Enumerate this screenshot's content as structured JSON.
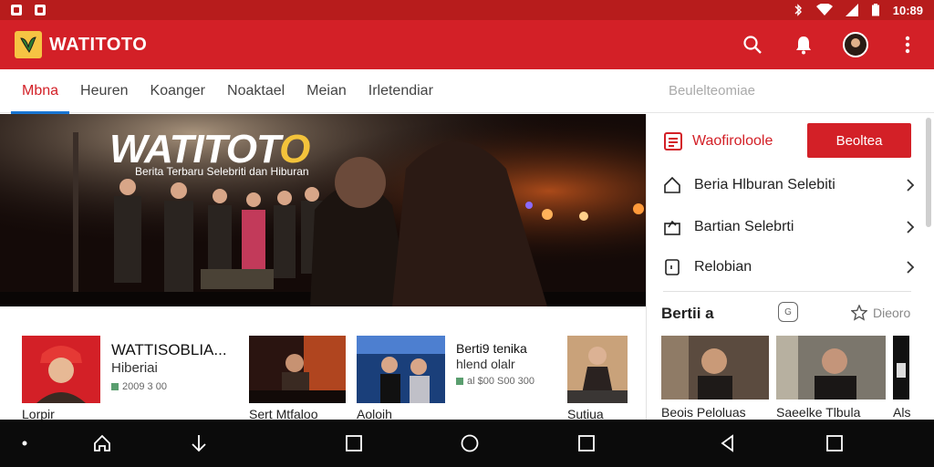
{
  "status": {
    "time": "10:89"
  },
  "appbar": {
    "title": "WATITOTO"
  },
  "tabs": [
    "Mbna",
    "Heuren",
    "Koanger",
    "Noaktael",
    "Meian",
    "Irletendiar"
  ],
  "tabs_extra": "Beulelteomiae",
  "hero": {
    "title_main": "WATITOT",
    "title_end": "O",
    "subtitle": "Berita Terbaru Selebriti dan Hiburan"
  },
  "side": {
    "header": "Waofiroloole",
    "button": "Beoltea",
    "items": [
      "Beria Hlburan Selebiti",
      "Bartian Selebrti",
      "Relobian"
    ],
    "section_title": "Bertii a",
    "section_more": "Dieoro",
    "videos": [
      "Beois Peloluas",
      "Saeelke Tlbula",
      "Als"
    ]
  },
  "news": [
    {
      "title": "WATTISOBLIA...",
      "sub": "Hiberiai",
      "meta": "2009 3 00",
      "cap": "Lorpir"
    },
    {
      "title": "",
      "sub": "",
      "meta": "",
      "cap": "Sert Mtfaloo"
    },
    {
      "title": "Berti9 tenika",
      "sub": "hlend olalr",
      "meta": "al $00 S00 300",
      "cap": "Aoloih"
    },
    {
      "title": "",
      "sub": "",
      "meta": "",
      "cap": "Sutiua"
    }
  ],
  "colors": {
    "primary": "#d32027",
    "status": "#b71c1c",
    "accent": "#f3c33b",
    "tab_indicator": "#1976d2"
  }
}
